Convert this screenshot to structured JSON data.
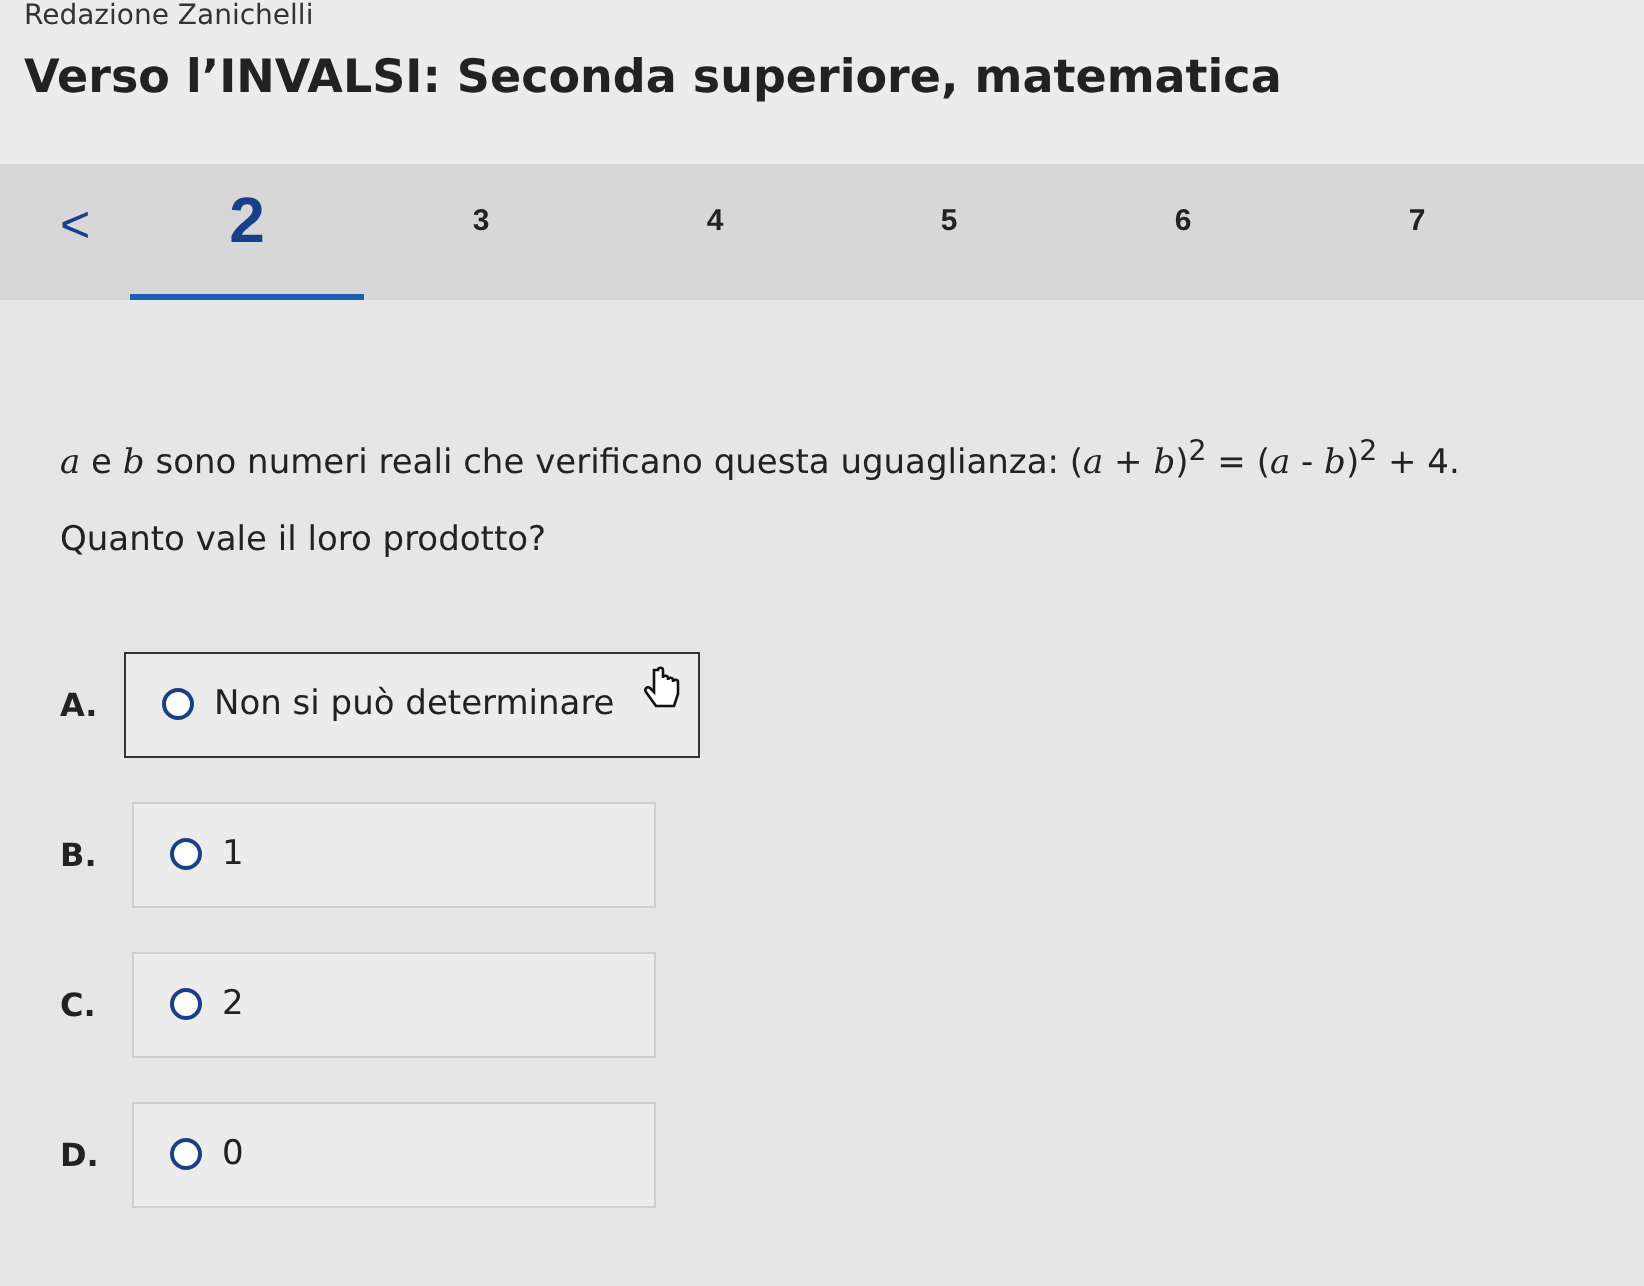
{
  "header": {
    "publisher": "Redazione Zanichelli",
    "title": "Verso l’INVALSI: Seconda superiore, matematica"
  },
  "nav": {
    "prev": "<",
    "tabs": [
      {
        "label": "2",
        "selected": true
      },
      {
        "label": "3",
        "selected": false
      },
      {
        "label": "4",
        "selected": false
      },
      {
        "label": "5",
        "selected": false
      },
      {
        "label": "6",
        "selected": false
      },
      {
        "label": "7",
        "selected": false
      }
    ]
  },
  "question": {
    "text": "*a* e *b* sono numeri reali che verificano questa uguaglianza: (*a* + *b*)$^{2}$ = (*a* - *b*)$^{2}$ + 4.",
    "prompt": "Quanto vale il loro prodotto?"
  },
  "options": [
    {
      "letter": "A.",
      "text": "Non si può determinare",
      "selected": false,
      "hovered": true
    },
    {
      "letter": "B.",
      "text": "1",
      "selected": false,
      "hovered": false
    },
    {
      "letter": "C.",
      "text": "2",
      "selected": false,
      "hovered": false
    },
    {
      "letter": "D.",
      "text": "0",
      "selected": false,
      "hovered": false
    }
  ]
}
